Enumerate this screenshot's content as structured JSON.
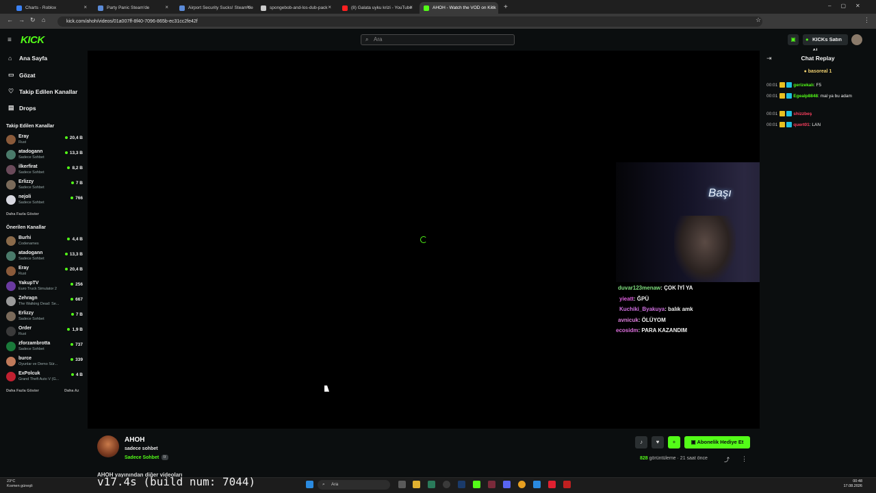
{
  "tabs": [
    {
      "title": "Charts - Roblox",
      "color": "#3b82f6"
    },
    {
      "title": "Party Panic Steam'de",
      "color": "#5b8bd8"
    },
    {
      "title": "Airport Security Sucks! Steam'de",
      "color": "#5b8bd8"
    },
    {
      "title": "spongebob-and-los-dub-pack",
      "color": "#cccccc"
    },
    {
      "title": "(8) Galata uyku krizi - YouTube",
      "color": "#ff2020"
    },
    {
      "title": "AHOH - Watch the VOD on Kick",
      "color": "#53fc18"
    }
  ],
  "address": {
    "url": "kick.com/ahoh/videos/01a007ff-8f40-7096-865b-ec31cc2fe42f"
  },
  "header": {
    "logo": "KICK",
    "search_placeholder": "Ara",
    "buy_kicks": "KICKs Satın Al"
  },
  "sidebar": {
    "nav": [
      {
        "label": "Ana Sayfa",
        "icon": "⌂"
      },
      {
        "label": "Gözat",
        "icon": "▭"
      },
      {
        "label": "Takip Edilen Kanallar",
        "icon": "♡"
      },
      {
        "label": "Drops",
        "icon": "▤"
      }
    ],
    "followed_title": "Takip Edilen Kanallar",
    "followed": [
      {
        "name": "Eray",
        "sub": "Rust",
        "viewers": "20,4 B",
        "color": "#8a5a3a"
      },
      {
        "name": "atadogann",
        "sub": "Sadece Sohbet",
        "viewers": "13,3 B",
        "color": "#4a7a6a"
      },
      {
        "name": "ilkerfirat",
        "sub": "Sadece Sohbet",
        "viewers": "8,2 B",
        "color": "#6a4a5a"
      },
      {
        "name": "Erlizzy",
        "sub": "Sadece Sohbet",
        "viewers": "7 B",
        "color": "#7a6a5a"
      },
      {
        "name": "nejoli",
        "sub": "Sadece Sohbet",
        "viewers": "766",
        "color": "#d8d8e0"
      }
    ],
    "show_more": "Daha Fazla Göster",
    "recommended_title": "Önerilen Kanallar",
    "recommended": [
      {
        "name": "Burhi",
        "sub": "Codenames",
        "viewers": "4,4 B",
        "color": "#8a6a4a"
      },
      {
        "name": "atadogann",
        "sub": "Sadece Sohbet",
        "viewers": "13,3 B",
        "color": "#4a7a6a"
      },
      {
        "name": "Eray",
        "sub": "Rust",
        "viewers": "20,4 B",
        "color": "#8a5a3a"
      },
      {
        "name": "YakupTV",
        "sub": "Euro Truck Simulator 2",
        "viewers": "256",
        "color": "#6a3aa0"
      },
      {
        "name": "Zehragn",
        "sub": "The Walking Dead: Se...",
        "viewers": "667",
        "color": "#9a9a9a"
      },
      {
        "name": "Erlizzy",
        "sub": "Sadece Sohbet",
        "viewers": "7 B",
        "color": "#7a6a5a"
      },
      {
        "name": "Order",
        "sub": "Rust",
        "viewers": "1,9 B",
        "color": "#3a3a3a"
      },
      {
        "name": "zforzambrotta",
        "sub": "Sadece Sohbet",
        "viewers": "737",
        "color": "#1a7a3a"
      },
      {
        "name": "burce",
        "sub": "Oyunlar ve Demo Sür...",
        "viewers": "339",
        "color": "#c07a5a"
      },
      {
        "name": "ExPolcuk",
        "sub": "Grand Theft Auto V (G...",
        "viewers": "4 B",
        "color": "#c02030"
      }
    ],
    "show_more_2": "Daha Fazla Göster",
    "show_less": "Daha Az"
  },
  "overlay": {
    "neon": "Başı",
    "lines": [
      {
        "user": "duvar123menaw",
        "text": ": ÇOK İYİ YA",
        "color": "#7fe07f"
      },
      {
        "user": "yieatt",
        "text": ": ĞPÜ",
        "color": "#e060e0"
      },
      {
        "user": "Kuchiki_Byakuya",
        "text": ": balık amk",
        "color": "#d070e0"
      },
      {
        "user": "avnicuk",
        "text": ": ÖLÜYOM",
        "color": "#e080e0"
      },
      {
        "user": "ecosidm",
        "text": ": PARA KAZANDIM",
        "color": "#e070e0"
      }
    ]
  },
  "chat": {
    "title": "Chat Replay",
    "pinned": "basoreal 1",
    "messages": [
      {
        "time": "00:01",
        "user": "gerizekalı",
        "text": ": F5",
        "color": "#53fc18"
      },
      {
        "time": "00:01",
        "user": "Egealp8848",
        "text": ": mal ya bu adam",
        "color": "#53fc18"
      },
      {
        "time": "00:01",
        "user": "shizzbeş",
        "text": "",
        "color": "#ff4060"
      },
      {
        "time": "00:01",
        "user": "quert01",
        "text": ": LAN",
        "color": "#ff4060"
      }
    ]
  },
  "info": {
    "channel": "AHOH",
    "title": "sadece sohbet",
    "category": "Sadece Sohbet",
    "lang": "tr",
    "gift_sub": "Abonelik Hediye Et",
    "views": "828",
    "views_label": "görüntüleme",
    "ago": "21 saat önce",
    "desc": "AHOH yayınından diğer videoları"
  },
  "taskbar": {
    "temp": "23°C",
    "weather": "Kısmen güneşli",
    "build": "v17.4s (build num: 7044)",
    "search": "Ara",
    "time": "00:48",
    "date": "17.08.2026"
  }
}
